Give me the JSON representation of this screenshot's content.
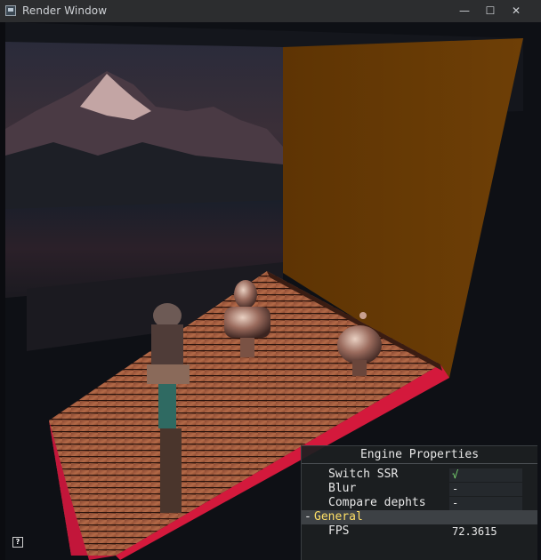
{
  "window": {
    "title": "Render Window",
    "minimize_glyph": "—",
    "maximize_glyph": "☐",
    "close_glyph": "✕"
  },
  "panel": {
    "title": "Engine Properties",
    "rows": [
      {
        "label": "Switch SSR",
        "value": "√"
      },
      {
        "label": "Blur",
        "value": "-"
      },
      {
        "label": "Compare dephts",
        "value": "-"
      }
    ],
    "group": {
      "toggle": "-",
      "label": "General"
    },
    "fps": {
      "label": "FPS",
      "value": "72.3615"
    }
  },
  "help_glyph": "?",
  "colors": {
    "floor": "#a85a3c",
    "back_wall": "#6e3d05",
    "floor_edge": "#d4193c",
    "title_text": "#cfd2d6",
    "group_label": "#ffe066",
    "check": "#7ddf74"
  },
  "icons": [
    "app-icon",
    "minimize-icon",
    "maximize-icon",
    "close-icon",
    "help-icon"
  ]
}
